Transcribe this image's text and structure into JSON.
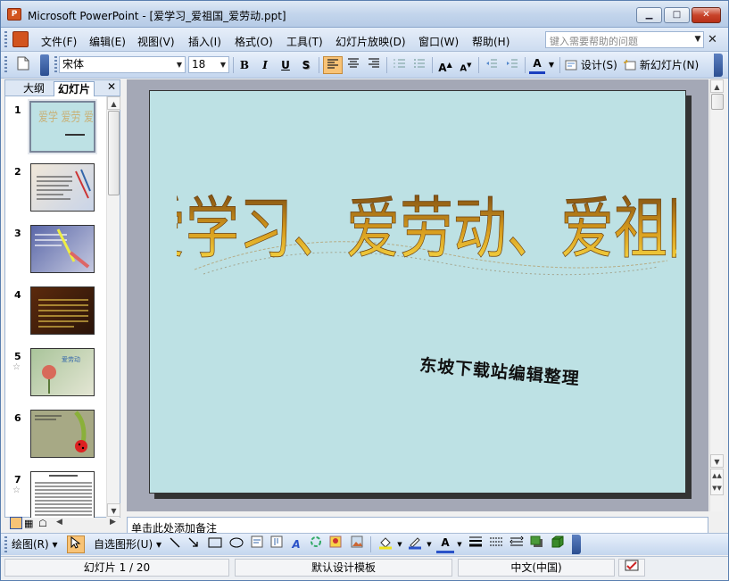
{
  "window": {
    "title": "Microsoft PowerPoint - [爱学习_爱祖国_爱劳动.ppt]",
    "app_icon_text": "P",
    "minimize": "▁",
    "maximize": "□",
    "close": "✕"
  },
  "menu": {
    "items": [
      "文件(F)",
      "编辑(E)",
      "视图(V)",
      "插入(I)",
      "格式(O)",
      "工具(T)",
      "幻灯片放映(D)",
      "窗口(W)",
      "帮助(H)"
    ],
    "help_placeholder": "键入需要帮助的问题",
    "close": "✕"
  },
  "toolbar": {
    "font_name": "宋体",
    "font_size": "18",
    "bold": "B",
    "italic": "I",
    "underline": "U",
    "shadow": "S",
    "design_label": "设计(S)",
    "new_slide_label": "新幻灯片(N)"
  },
  "panel": {
    "tab_outline": "大纲",
    "tab_slides": "幻灯片",
    "close": "✕",
    "slides": [
      {
        "num": "1",
        "star": ""
      },
      {
        "num": "2",
        "star": ""
      },
      {
        "num": "3",
        "star": ""
      },
      {
        "num": "4",
        "star": ""
      },
      {
        "num": "5",
        "star": "☆"
      },
      {
        "num": "6",
        "star": ""
      },
      {
        "num": "7",
        "star": "☆"
      }
    ]
  },
  "slide": {
    "wordart_text": "爱学习、爱劳动、爱祖国",
    "subtitle": "东坡下载站编辑整理",
    "background": "#bde1e4"
  },
  "notes": {
    "placeholder": "单击此处添加备注"
  },
  "drawbar": {
    "draw_label": "绘图(R)",
    "autoshape_label": "自选图形(U)"
  },
  "status": {
    "slide_info": "幻灯片 1 / 20",
    "template": "默认设计模板",
    "language": "中文(中国)"
  },
  "colors": {
    "accent": "#2c4f91",
    "wordart_gold": "#d9a21a",
    "slide_bg": "#bde1e4"
  }
}
